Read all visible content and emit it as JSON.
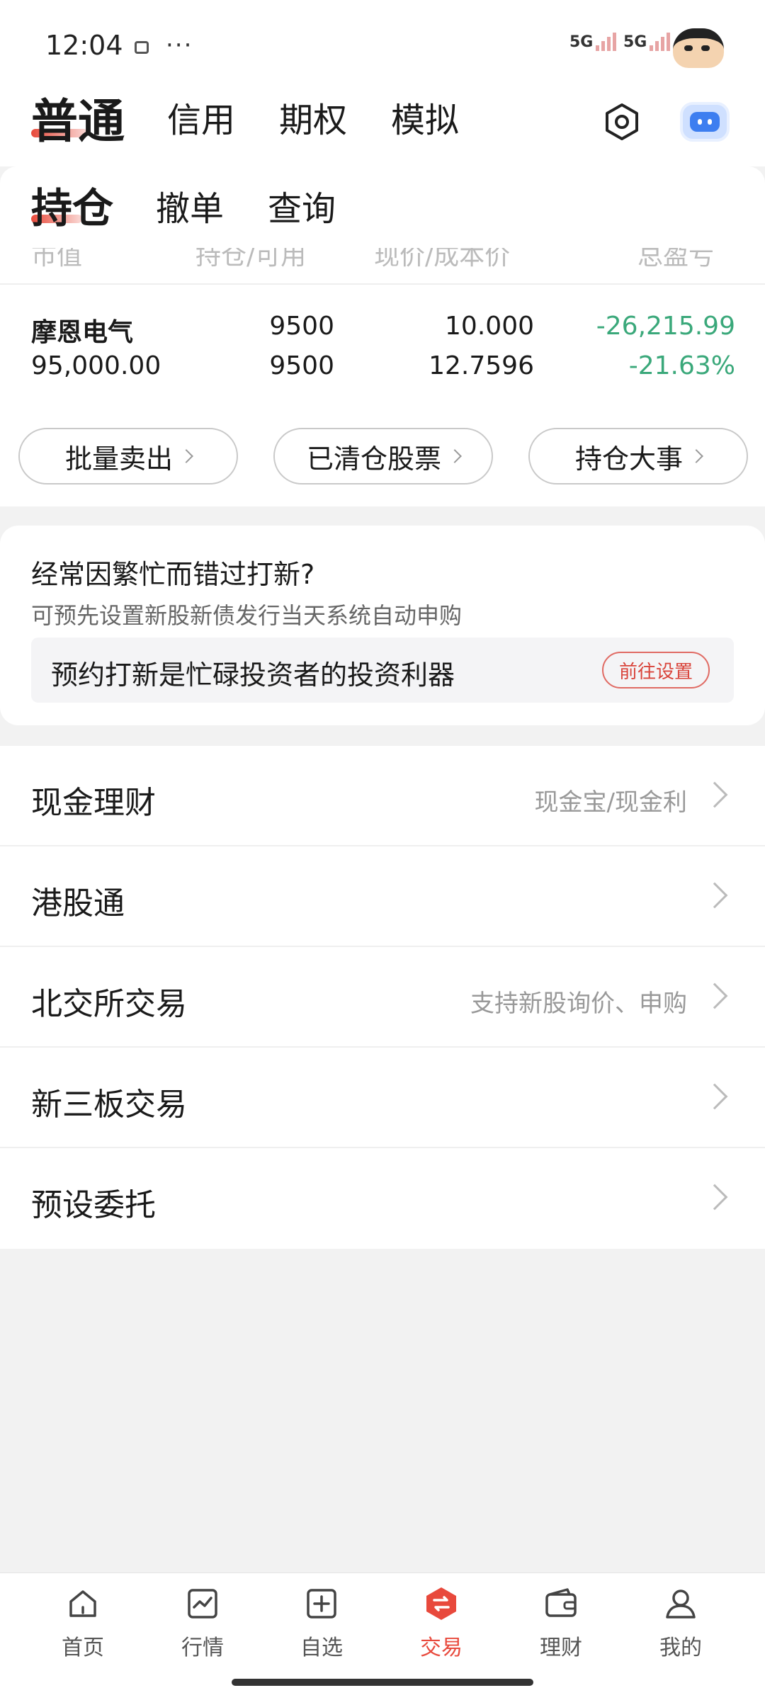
{
  "status": {
    "time": "12:04",
    "more": "···",
    "signal1": "5G",
    "signal2": "5G"
  },
  "header": {
    "tabs": [
      {
        "label": "普通"
      },
      {
        "label": "信用"
      },
      {
        "label": "期权"
      },
      {
        "label": "模拟"
      }
    ]
  },
  "subtabs": [
    {
      "label": "持仓"
    },
    {
      "label": "撤单"
    },
    {
      "label": "查询"
    }
  ],
  "holdings": {
    "columns": [
      "市值",
      "持仓/可用",
      "现价/成本价",
      "总盈亏"
    ],
    "rows": [
      {
        "name": "摩恩电气",
        "market_value": "95,000.00",
        "position": "9500",
        "available": "9500",
        "price": "10.000",
        "cost": "12.7596",
        "pnl": "-26,215.99",
        "pnl_pct": "-21.63%"
      }
    ],
    "actions": [
      {
        "label": "批量卖出"
      },
      {
        "label": "已清仓股票"
      },
      {
        "label": "持仓大事"
      }
    ]
  },
  "promo": {
    "title": "经常因繁忙而错过打新?",
    "subtitle": "可预先设置新股新债发行当天系统自动申购",
    "box_text": "预约打新是忙碌投资者的投资利器",
    "button": "前往设置"
  },
  "menu": [
    {
      "label": "现金理财",
      "hint": "现金宝/现金利"
    },
    {
      "label": "港股通",
      "hint": ""
    },
    {
      "label": "北交所交易",
      "hint": "支持新股询价、申购"
    },
    {
      "label": "新三板交易",
      "hint": ""
    },
    {
      "label": "预设委托",
      "hint": ""
    }
  ],
  "tabbar": [
    {
      "label": "首页",
      "icon": "home-icon"
    },
    {
      "label": "行情",
      "icon": "chart-icon"
    },
    {
      "label": "自选",
      "icon": "plus-square-icon"
    },
    {
      "label": "交易",
      "icon": "exchange-icon"
    },
    {
      "label": "理财",
      "icon": "wallet-icon"
    },
    {
      "label": "我的",
      "icon": "user-icon"
    }
  ],
  "colors": {
    "accent": "#e8493c",
    "loss": "#3aa87a"
  }
}
